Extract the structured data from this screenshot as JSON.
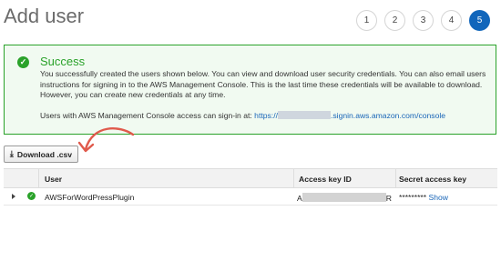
{
  "page": {
    "title": "Add user"
  },
  "steps": [
    "1",
    "2",
    "3",
    "4",
    "5"
  ],
  "active_step": "5",
  "alert": {
    "title": "Success",
    "body": "You successfully created the users shown below. You can view and download user security credentials. You can also email users instructions for signing in to the AWS Management Console. This is the last time these credentials will be available to download. However, you can create new credentials at any time.",
    "signin_prefix": "Users with AWS Management Console access can sign-in at:",
    "signin_link_start": "https://",
    "signin_link_end": ".signin.aws.amazon.com/console"
  },
  "download_button": {
    "label": "Download .csv",
    "icon": "download-icon"
  },
  "table": {
    "headers": [
      "User",
      "Access key ID",
      "Secret access key"
    ],
    "rows": [
      {
        "user": "AWSForWordPressPlugin",
        "access_key_prefix": "A",
        "access_key_suffix": "R",
        "secret_mask": "*********",
        "show_label": "Show"
      }
    ]
  },
  "colors": {
    "success": "#2aa22a",
    "link": "#1a66b8",
    "active_step": "#1166bb",
    "arrow": "#e05a4c"
  }
}
